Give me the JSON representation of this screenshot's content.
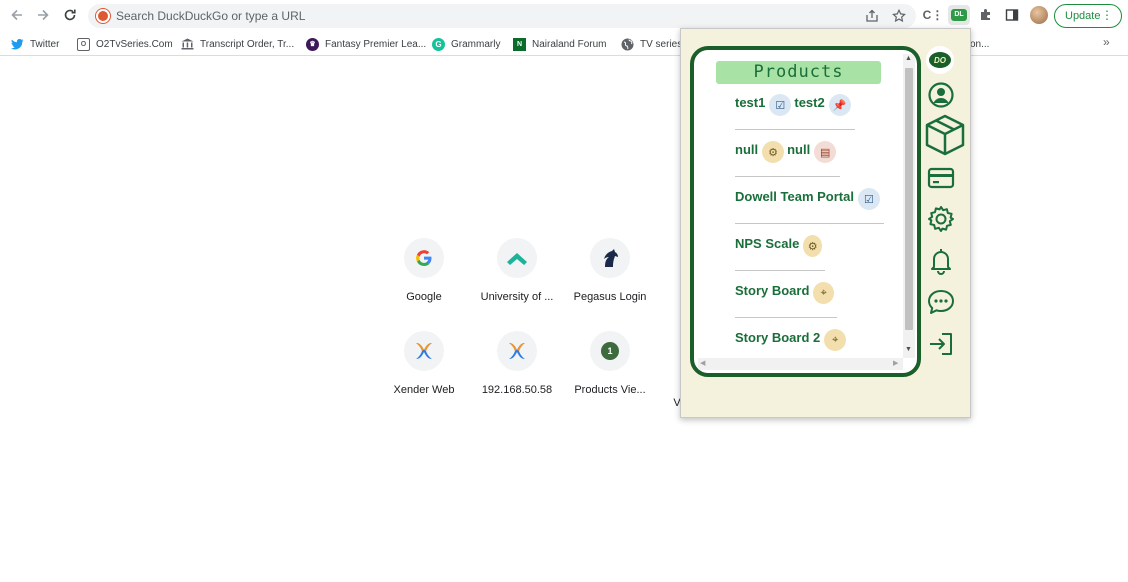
{
  "toolbar": {
    "back_icon": "arrow-left-icon",
    "forward_icon": "arrow-right-icon",
    "reload_icon": "reload-icon",
    "omnibox_placeholder": "Search DuckDuckGo or type a URL",
    "extension_badge": "DL",
    "update_label": "Update"
  },
  "bookmarks": [
    {
      "label": "Twitter",
      "icon": "twitter-icon",
      "color": "#1d9bf0"
    },
    {
      "label": "O2TvSeries.Com",
      "icon": "o2tv-icon",
      "color": "#5f6368"
    },
    {
      "label": "Transcript Order, Tr...",
      "icon": "bank-icon",
      "color": "#5f6368"
    },
    {
      "label": "Fantasy Premier Lea...",
      "icon": "premier-league-icon",
      "color": "#3d195b"
    },
    {
      "label": "Grammarly",
      "icon": "grammarly-icon",
      "color": "#15c39a"
    },
    {
      "label": "Nairaland Forum",
      "icon": "nairaland-icon",
      "color": "#0a6b2a"
    },
    {
      "label": "TV series,",
      "icon": "globe-icon",
      "color": "#5f6368"
    }
  ],
  "bookmarks_overflow_fragment": "on...",
  "shortcuts": [
    {
      "label": "Google",
      "icon": "google-icon"
    },
    {
      "label": "University of ...",
      "icon": "university-icon"
    },
    {
      "label": "Pegasus Login",
      "icon": "pegasus-icon"
    },
    {
      "label": "Xender Web",
      "icon": "xender-icon"
    },
    {
      "label": "192.168.50.58",
      "icon": "xender-icon"
    },
    {
      "label": "Products Vie...",
      "icon": "number-badge-icon",
      "badge": "1"
    }
  ],
  "shortcut_fragment": "V",
  "popup": {
    "header": "Products",
    "rows": [
      {
        "items": [
          {
            "name": "test1",
            "badge_icon": "clipboard-check-icon"
          },
          {
            "name": "test2",
            "badge_icon": "clipboard-pin-icon"
          }
        ]
      },
      {
        "items": [
          {
            "name": "null",
            "badge_icon": "gear-badge-icon"
          },
          {
            "name": "null",
            "badge_icon": "clipboard-icon"
          }
        ]
      },
      {
        "items": [
          {
            "name": "Dowell Team Portal",
            "badge_icon": "clipboard-check-icon"
          }
        ]
      },
      {
        "items": [
          {
            "name": "NPS Scale",
            "badge_icon": "gear-badge-icon"
          }
        ]
      },
      {
        "items": [
          {
            "name": "Story Board",
            "badge_icon": "target-badge-icon"
          }
        ]
      },
      {
        "items": [
          {
            "name": "Story Board 2",
            "badge_icon": "target-badge-icon"
          }
        ]
      }
    ],
    "side_logo": "DO",
    "side_icons": [
      "dowell-logo-icon",
      "user-icon",
      "box-icon",
      "credit-card-icon",
      "settings-icon",
      "bell-icon",
      "chat-icon",
      "logout-icon"
    ],
    "accent_color": "#1a6e3a"
  }
}
